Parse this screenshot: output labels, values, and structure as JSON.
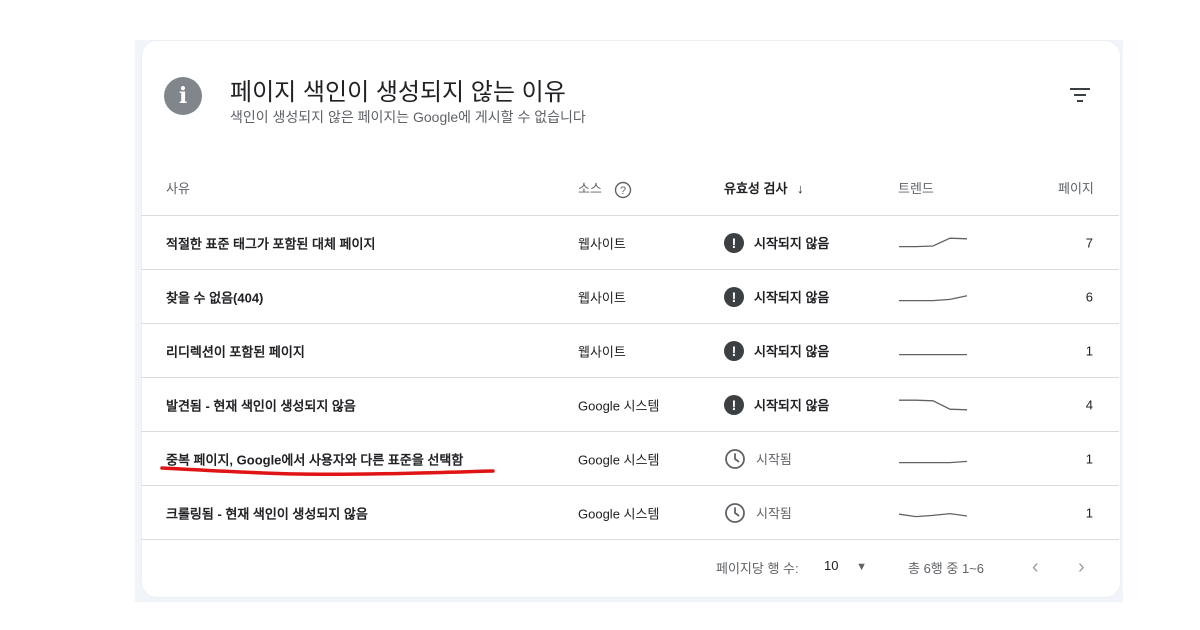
{
  "header": {
    "title": "페이지 색인이 생성되지 않는 이유",
    "subtitle": "색인이 생성되지 않은 페이지는 Google에 게시할 수 없습니다",
    "info_icon": "info-icon",
    "filter_icon": "filter-icon"
  },
  "columns": {
    "reason": "사유",
    "source": "소스",
    "validation": "유효성 검사",
    "sort_arrow": "↓",
    "trend": "트렌드",
    "pages": "페이지"
  },
  "rows": [
    {
      "reason": "적절한 표준 태그가 포함된 대체 페이지",
      "source": "웹사이트",
      "status": "시작되지 않음",
      "status_type": "not-started",
      "pages": "7",
      "trend": [
        0.2,
        0.2,
        0.25,
        0.9,
        0.85
      ]
    },
    {
      "reason": "찾을 수 없음(404)",
      "source": "웹사이트",
      "status": "시작되지 않음",
      "status_type": "not-started",
      "pages": "6",
      "trend": [
        0.2,
        0.2,
        0.2,
        0.3,
        0.6
      ]
    },
    {
      "reason": "리디렉션이 포함된 페이지",
      "source": "웹사이트",
      "status": "시작되지 않음",
      "status_type": "not-started",
      "pages": "1",
      "trend": [
        0.2,
        0.2,
        0.2,
        0.2,
        0.2
      ]
    },
    {
      "reason": "발견됨 - 현재 색인이 생성되지 않음",
      "source": "Google 시스템",
      "status": "시작되지 않음",
      "status_type": "not-started",
      "pages": "4",
      "trend": [
        0.9,
        0.9,
        0.85,
        0.15,
        0.1
      ]
    },
    {
      "reason": "중복 페이지, Google에서 사용자와 다른 표준을 선택함",
      "source": "Google 시스템",
      "status": "시작됨",
      "status_type": "started",
      "pages": "1",
      "trend": [
        0.2,
        0.2,
        0.2,
        0.2,
        0.3
      ]
    },
    {
      "reason": "크롤링됨 - 현재 색인이 생성되지 않음",
      "source": "Google 시스템",
      "status": "시작됨",
      "status_type": "started",
      "pages": "1",
      "trend": [
        0.4,
        0.2,
        0.3,
        0.45,
        0.25
      ]
    }
  ],
  "footer": {
    "rows_per_page_label": "페이지당 행 수:",
    "rows_per_page_value": "10",
    "range": "총 6행 중 1~6",
    "prev": "‹",
    "next": "›"
  },
  "colors": {
    "annotation_underline": "#e01414",
    "trend_line": "#5f6368",
    "divider": "#dadce0"
  }
}
